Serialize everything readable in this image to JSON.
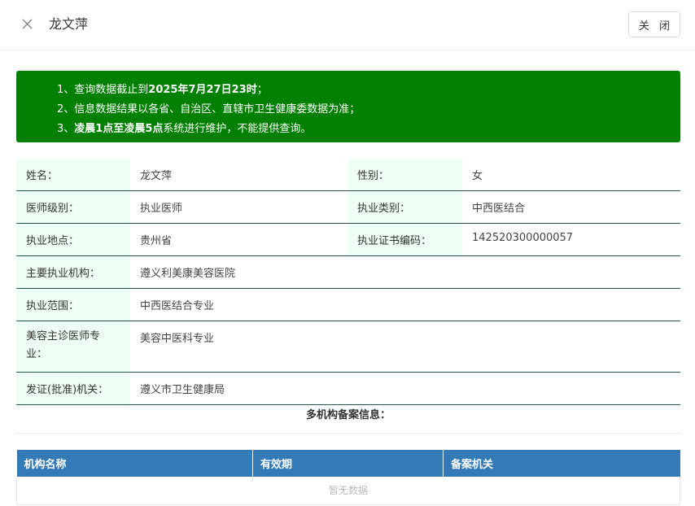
{
  "header": {
    "title": "龙文萍",
    "close_button_label": "关 闭"
  },
  "notice": {
    "line1_prefix": "1、查询数据截止到",
    "line1_bold": "2025年7月27日23时",
    "line1_suffix": "；",
    "line2": "2、信息数据结果以各省、自治区、直辖市卫生健康委数据为准；",
    "line3_prefix": "3、",
    "line3_bold": "凌晨1点至凌晨5点",
    "line3_suffix": "系统进行维护，不能提供查询。"
  },
  "info": {
    "name_label": "姓名：",
    "name_value": "龙文萍",
    "gender_label": "性别：",
    "gender_value": "女",
    "level_label": "医师级别：",
    "level_value": "执业医师",
    "category_label": "执业类别：",
    "category_value": "中西医结合",
    "location_label": "执业地点：",
    "location_value": "贵州省",
    "cert_label": "执业证书编码：",
    "cert_value": "142520300000057",
    "institution_label": "主要执业机构：",
    "institution_value": "遵义利美康美容医院",
    "scope_label": "执业范围：",
    "scope_value": "中西医结合专业",
    "cosmetic_label": "美容主诊医师专业：",
    "cosmetic_value": "美容中医科专业",
    "issuer_label": "发证(批准)机关：",
    "issuer_value": "遵义市卫生健康局"
  },
  "multi": {
    "title": "多机构备案信息：",
    "columns": [
      "机构名称",
      "有效期",
      "备案机关"
    ],
    "empty_text": "暂无数据"
  }
}
